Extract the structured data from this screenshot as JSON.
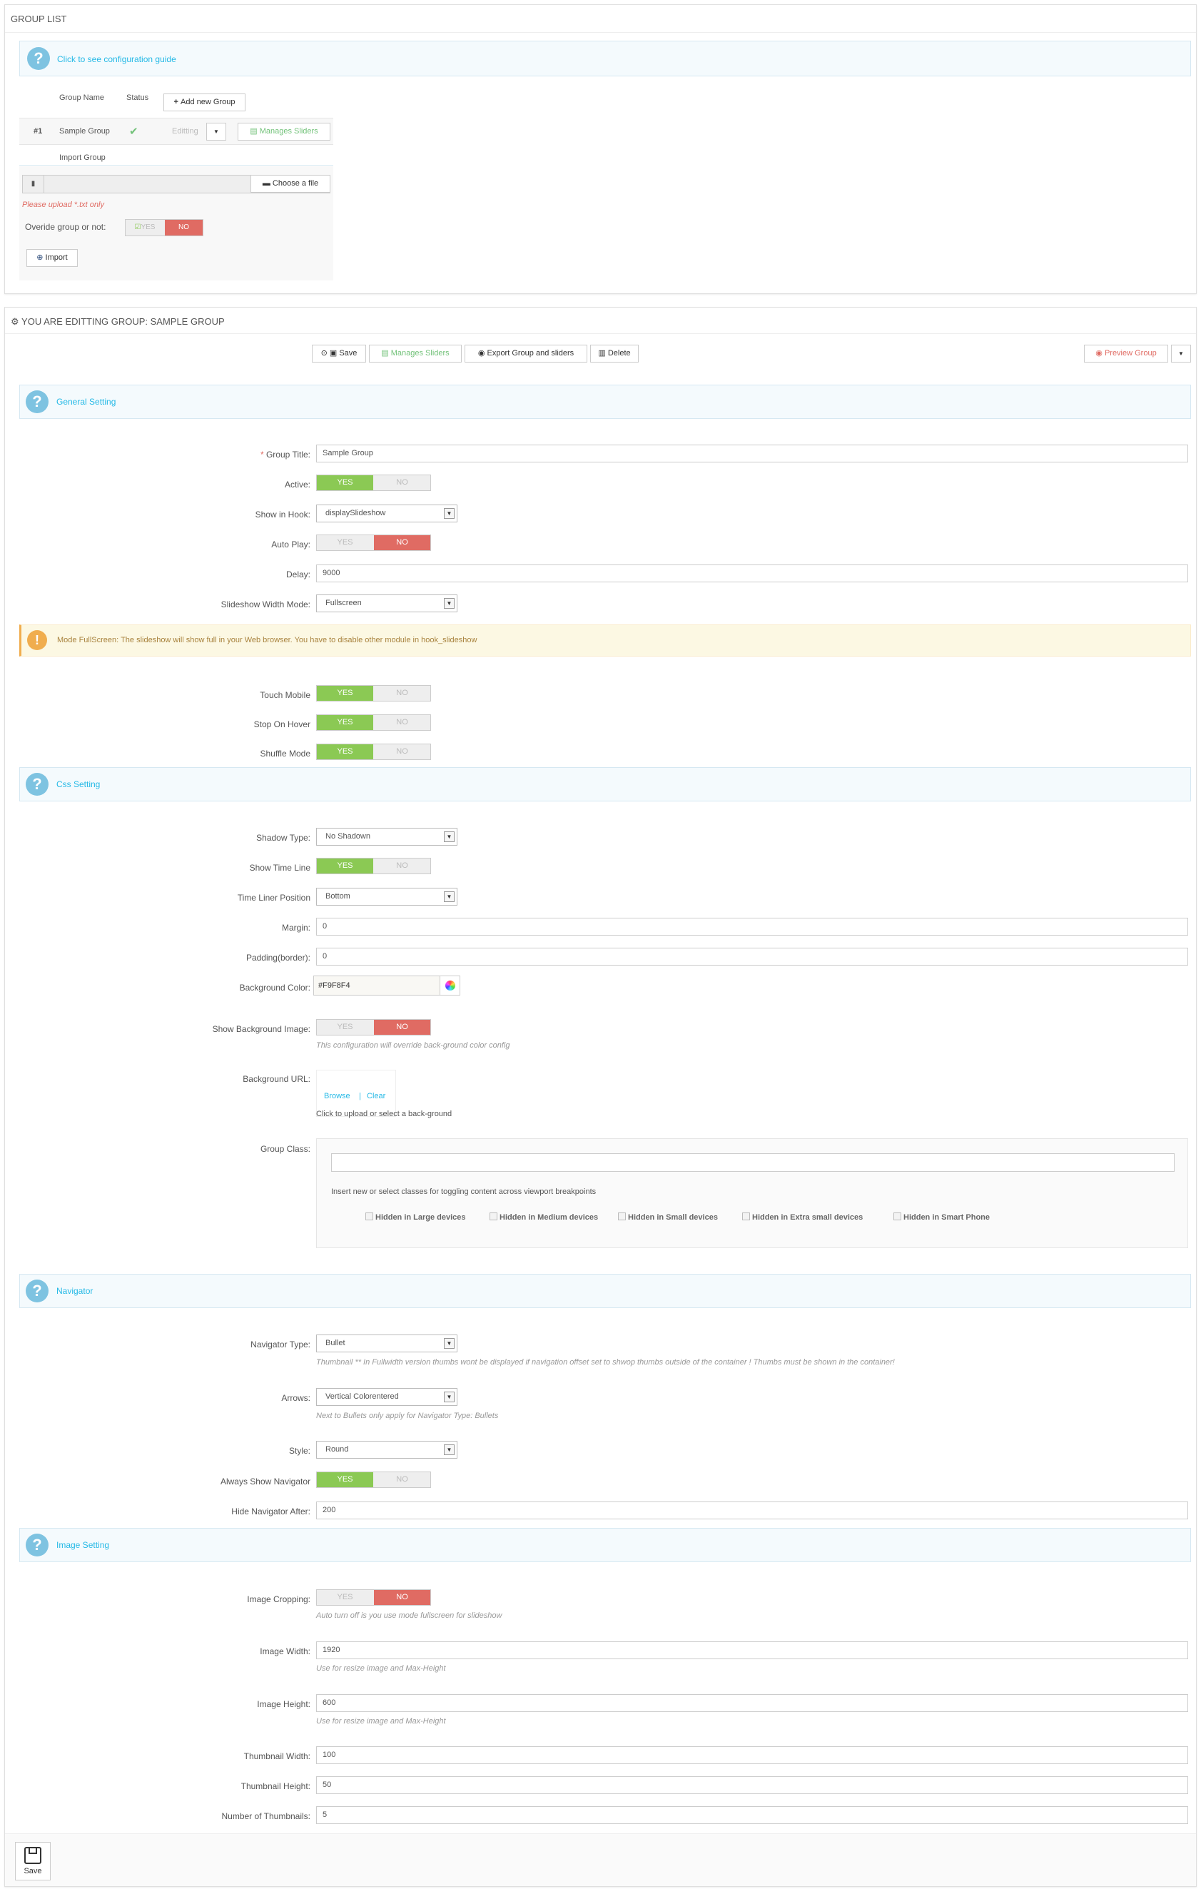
{
  "group_list": {
    "title": "GROUP LIST",
    "guide": "Click to see configuration guide",
    "col_name": "Group Name",
    "col_status": "Status",
    "add_btn": "Add new Group",
    "row_id": "#1",
    "row_name": "Sample Group",
    "editing": "Editting",
    "manage_btn": "Manages Sliders",
    "import_group": "Import Group",
    "choose_file": "Choose a file",
    "upload_note": "Please upload *.txt only",
    "override_label": "Overide group or not:",
    "override_yes": "YES",
    "override_no": "NO",
    "import_btn": "Import"
  },
  "editing": {
    "title": "YOU ARE EDITTING GROUP: SAMPLE GROUP",
    "save": "Save",
    "manage": "Manages Sliders",
    "export": "Export Group and sliders",
    "delete": "Delete",
    "preview": "Preview Group"
  },
  "general": {
    "title": "General Setting",
    "group_title_req": "*",
    "group_title_label": "Group Title:",
    "group_title_value": "Sample Group",
    "active_label": "Active:",
    "hook_label": "Show in Hook:",
    "hook_value": "displaySlideshow",
    "autoplay_label": "Auto Play:",
    "delay_label": "Delay:",
    "delay_value": "9000",
    "width_mode_label": "Slideshow Width Mode:",
    "width_mode_value": "Fullscreen",
    "warning": "Mode FullScreen: The slideshow will show full in your Web browser. You have to disable other module in hook_slideshow",
    "touch_label": "Touch Mobile",
    "hover_label": "Stop On Hover",
    "shuffle_label": "Shuffle Mode"
  },
  "toggle": {
    "yes": "YES",
    "no": "NO"
  },
  "css": {
    "title": "Css Setting",
    "shadow_label": "Shadow Type:",
    "shadow_value": "No Shadown",
    "timeline_label": "Show Time Line",
    "timeliner_label": "Time Liner Position",
    "timeliner_value": "Bottom",
    "margin_label": "Margin:",
    "margin_value": "0",
    "padding_label": "Padding(border):",
    "padding_value": "0",
    "bgcolor_label": "Background Color:",
    "bgcolor_value": "#F9F8F4",
    "showbg_label": "Show Background Image:",
    "showbg_help": "This configuration will override back-ground color config",
    "bgurl_label": "Background URL:",
    "browse": "Browse",
    "pipe": "|",
    "clear": "Clear",
    "bgurl_help": "Click to upload or select a back-ground",
    "class_label": "Group Class:",
    "class_help": "Insert new or select classes for toggling content across viewport breakpoints",
    "cb": [
      "Hidden in Large devices",
      "Hidden in Medium devices",
      "Hidden in Small devices",
      "Hidden in Extra small devices",
      "Hidden in Smart Phone"
    ]
  },
  "nav": {
    "title": "Navigator",
    "type_label": "Navigator Type:",
    "type_value": "Bullet",
    "type_help": "Thumbnail ** In Fullwidth version thumbs wont be displayed if navigation offset set to shwop thumbs outside of the container ! Thumbs must be shown in the container!",
    "arrows_label": "Arrows:",
    "arrows_value": "Vertical Colorentered",
    "arrows_help": "Next to Bullets only apply for Navigator Type: Bullets",
    "style_label": "Style:",
    "style_value": "Round",
    "always_label": "Always Show Navigator",
    "hide_label": "Hide Navigator After:",
    "hide_value": "200"
  },
  "image": {
    "title": "Image Setting",
    "crop_label": "Image Cropping:",
    "crop_help": "Auto turn off is you use mode fullscreen for slideshow",
    "width_label": "Image Width:",
    "width_value": "1920",
    "width_help": "Use for resize image and Max-Height",
    "height_label": "Image Height:",
    "height_value": "600",
    "height_help": "Use for resize image and Max-Height",
    "thumb_w_label": "Thumbnail Width:",
    "thumb_w_value": "100",
    "thumb_h_label": "Thumbnail Height:",
    "thumb_h_value": "50",
    "thumb_n_label": "Number of Thumbnails:",
    "thumb_n_value": "5"
  },
  "footer": {
    "save": "Save"
  },
  "colors": {
    "accent": "#25b9e6",
    "yes": "#8bc954",
    "no": "#e06b63"
  }
}
